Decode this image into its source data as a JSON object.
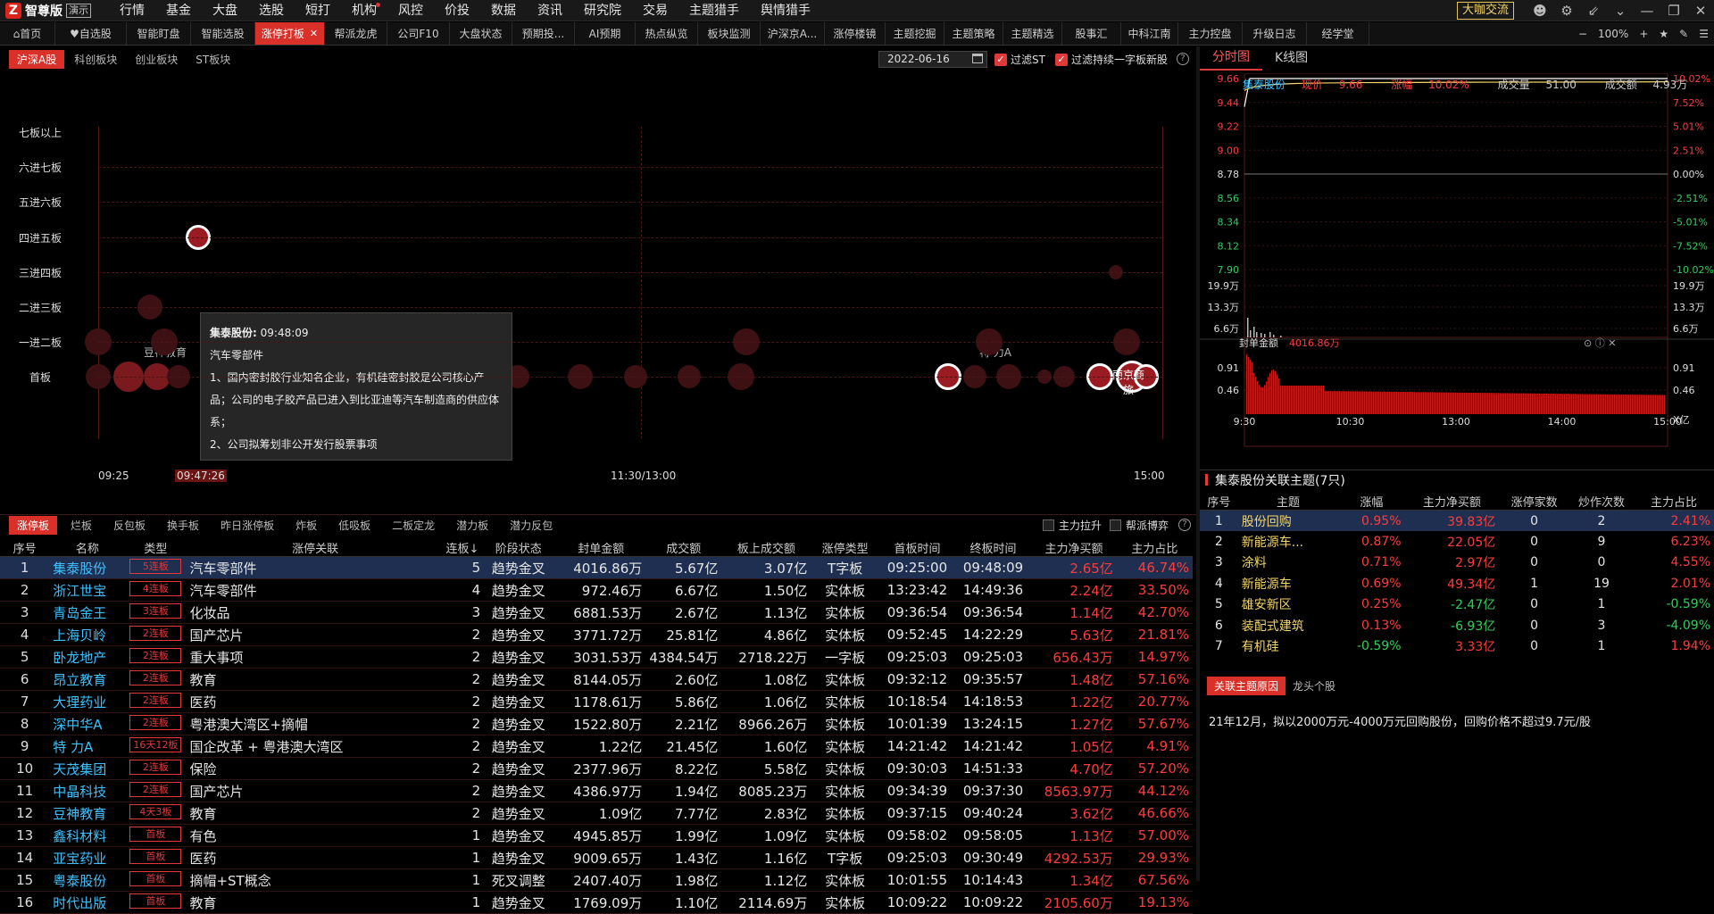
{
  "app": {
    "logo_mark": "Z",
    "name": "智尊版",
    "demo": "演示"
  },
  "menu": [
    "行情",
    "基金",
    "大盘",
    "选股",
    "短打",
    "机构",
    "风控",
    "价投",
    "数据",
    "资讯",
    "研究院",
    "交易",
    "主题猎手",
    "舆情猎手"
  ],
  "top_right": {
    "chat": "大咖交流"
  },
  "tabs": [
    {
      "label": "首页",
      "icon": "home-icon",
      "w": 62
    },
    {
      "label": "自选股",
      "icon": "heart-icon",
      "w": 80
    },
    {
      "label": "智能盯盘",
      "w": 72
    },
    {
      "label": "智能选股",
      "w": 72
    },
    {
      "label": "涨停打板",
      "active": true,
      "w": 78
    },
    {
      "label": "帮派龙虎",
      "w": 70
    },
    {
      "label": "公司F10",
      "w": 70
    },
    {
      "label": "大盘状态",
      "w": 70
    },
    {
      "label": "预期投...",
      "w": 70
    },
    {
      "label": "AI预期",
      "w": 68
    },
    {
      "label": "热点纵览",
      "w": 70
    },
    {
      "label": "板块监测",
      "w": 70
    },
    {
      "label": "沪深京A...",
      "w": 72
    },
    {
      "label": "涨停楼镜",
      "w": 68
    },
    {
      "label": "主题挖掘",
      "w": 66
    },
    {
      "label": "主题策略",
      "w": 66
    },
    {
      "label": "主题精选",
      "w": 66
    },
    {
      "label": "股事汇",
      "w": 66
    },
    {
      "label": "中科江南",
      "w": 64
    },
    {
      "label": "主力控盘",
      "w": 72
    },
    {
      "label": "升级日志",
      "w": 72
    },
    {
      "label": "经学堂",
      "w": 70
    }
  ],
  "tab_tools": {
    "minus": "−",
    "zoom": "100%",
    "plus": "+"
  },
  "subtabs": [
    "沪深A股",
    "科创板块",
    "创业板块",
    "ST板块"
  ],
  "filter": {
    "date": "2022-06-16",
    "st": "过滤ST",
    "new": "过滤持续一字板新股"
  },
  "levels": [
    "七板以上",
    "六进七板",
    "五进六板",
    "四进五板",
    "三进四板",
    "二进三板",
    "一进二板",
    "首板"
  ],
  "time_axis": {
    "start": "09:25",
    "cursor": "09:47:26",
    "mid": "11:30/13:00",
    "end": "15:00"
  },
  "bubble_labels": [
    "豆神教育",
    "特 力A",
    "南京商旅"
  ],
  "tooltip": {
    "name": "集泰股份:",
    "time": "09:48:09",
    "sector": "汽车零部件",
    "line1": "1、国内密封胶行业知名企业，有机硅密封胶是公司核心产品；公司的电子胶产品已进入到比亚迪等汽车制造商的供应体系；",
    "line2": "2、公司拟筹划非公开发行股票事项"
  },
  "bottom_tabs": [
    "涨停板",
    "烂板",
    "反包板",
    "换手板",
    "昨日涨停板",
    "炸板",
    "低吸板",
    "二板定龙",
    "潜力板",
    "潜力反包"
  ],
  "bottom_checks": [
    "主力拉升",
    "帮派博弈"
  ],
  "main_headers": [
    "序号",
    "名称",
    "类型",
    "涨停关联",
    "连板↓",
    "阶段状态",
    "封单金额",
    "成交额",
    "板上成交额",
    "涨停类型",
    "首板时间",
    "终板时间",
    "主力净买额",
    "主力占比"
  ],
  "rows": [
    [
      "1",
      "集泰股份",
      "5连板",
      "汽车零部件",
      "5",
      "趋势金叉",
      "4016.86万",
      "5.67亿",
      "3.07亿",
      "T字板",
      "09:25:00",
      "09:48:09",
      "2.65亿",
      "46.74%"
    ],
    [
      "2",
      "浙江世宝",
      "4连板",
      "汽车零部件",
      "4",
      "趋势金叉",
      "972.46万",
      "6.67亿",
      "1.50亿",
      "实体板",
      "13:23:42",
      "14:49:36",
      "2.24亿",
      "33.50%"
    ],
    [
      "3",
      "青岛金王",
      "3连板",
      "化妆品",
      "3",
      "趋势金叉",
      "6881.53万",
      "2.67亿",
      "1.13亿",
      "实体板",
      "09:36:54",
      "09:36:54",
      "1.14亿",
      "42.70%"
    ],
    [
      "4",
      "上海贝岭",
      "2连板",
      "国产芯片",
      "2",
      "趋势金叉",
      "3771.72万",
      "25.81亿",
      "4.86亿",
      "实体板",
      "09:52:45",
      "14:22:29",
      "5.63亿",
      "21.81%"
    ],
    [
      "5",
      "卧龙地产",
      "2连板",
      "重大事项",
      "2",
      "趋势金叉",
      "3031.53万",
      "4384.54万",
      "2718.22万",
      "一字板",
      "09:25:03",
      "09:25:03",
      "656.43万",
      "14.97%"
    ],
    [
      "6",
      "昂立教育",
      "2连板",
      "教育",
      "2",
      "趋势金叉",
      "8144.05万",
      "2.60亿",
      "1.08亿",
      "实体板",
      "09:32:12",
      "09:35:57",
      "1.48亿",
      "57.16%"
    ],
    [
      "7",
      "大理药业",
      "2连板",
      "医药",
      "2",
      "趋势金叉",
      "1178.61万",
      "5.86亿",
      "1.06亿",
      "实体板",
      "10:18:54",
      "14:18:53",
      "1.22亿",
      "20.77%"
    ],
    [
      "8",
      "深中华A",
      "2连板",
      "粤港澳大湾区+摘帽",
      "2",
      "趋势金叉",
      "1522.80万",
      "2.21亿",
      "8966.26万",
      "实体板",
      "10:01:39",
      "13:24:15",
      "1.27亿",
      "57.67%"
    ],
    [
      "9",
      "特 力A",
      "16天12板",
      "国企改革 + 粤港澳大湾区",
      "2",
      "趋势金叉",
      "1.22亿",
      "21.45亿",
      "1.60亿",
      "实体板",
      "14:21:42",
      "14:21:42",
      "1.05亿",
      "4.91%"
    ],
    [
      "10",
      "天茂集团",
      "2连板",
      "保险",
      "2",
      "趋势金叉",
      "2377.96万",
      "8.22亿",
      "5.58亿",
      "实体板",
      "09:30:03",
      "14:51:33",
      "4.70亿",
      "57.20%"
    ],
    [
      "11",
      "中晶科技",
      "2连板",
      "国产芯片",
      "2",
      "趋势金叉",
      "4386.97万",
      "1.94亿",
      "8085.23万",
      "实体板",
      "09:34:39",
      "09:37:30",
      "8563.97万",
      "44.12%"
    ],
    [
      "12",
      "豆神教育",
      "4天3板",
      "教育",
      "2",
      "趋势金叉",
      "1.09亿",
      "7.77亿",
      "2.83亿",
      "实体板",
      "09:37:15",
      "09:40:24",
      "3.62亿",
      "46.66%"
    ],
    [
      "13",
      "鑫科材料",
      "首板",
      "有色",
      "1",
      "趋势金叉",
      "4945.85万",
      "1.99亿",
      "1.09亿",
      "实体板",
      "09:58:02",
      "09:58:05",
      "1.13亿",
      "57.00%"
    ],
    [
      "14",
      "亚宝药业",
      "首板",
      "医药",
      "1",
      "趋势金叉",
      "9009.65万",
      "1.43亿",
      "1.16亿",
      "T字板",
      "09:25:03",
      "09:30:49",
      "4292.53万",
      "29.93%"
    ],
    [
      "15",
      "粤泰股份",
      "首板",
      "摘帽+ST概念",
      "1",
      "死叉调整",
      "2407.40万",
      "1.98亿",
      "1.12亿",
      "实体板",
      "10:01:55",
      "10:14:43",
      "1.34亿",
      "67.56%"
    ],
    [
      "16",
      "时代出版",
      "首板",
      "教育",
      "1",
      "趋势金叉",
      "1769.09万",
      "1.10亿",
      "2114.69万",
      "实体板",
      "10:09:22",
      "10:09:22",
      "2105.60万",
      "19.13%"
    ]
  ],
  "right_tabs": [
    "分时图",
    "K线图"
  ],
  "quote": {
    "name": "集泰股份",
    "price_label": "现价",
    "price": "9.66",
    "chg_label": "涨幅",
    "chg": "10.02%",
    "vol_label": "成交量",
    "vol": "51.00",
    "amt_label": "成交额",
    "amt": "4.93万"
  },
  "price_axis": [
    "9.66",
    "9.44",
    "9.22",
    "9.00",
    "8.78",
    "8.56",
    "8.34",
    "8.12",
    "7.90"
  ],
  "pct_axis": [
    "10.02%",
    "7.52%",
    "5.01%",
    "2.51%",
    "0.00%",
    "-2.51%",
    "-5.01%",
    "-7.52%",
    "-10.02%"
  ],
  "vol_axis": [
    "19.9万",
    "13.3万",
    "6.6万"
  ],
  "seal": {
    "label": "封单金额",
    "value": "4016.86万",
    "axis": [
      "0.91",
      "0.46"
    ],
    "unit": "X亿"
  },
  "time_ticks": [
    "9:30",
    "10:30",
    "13:00",
    "14:00",
    "15:00"
  ],
  "chart_data": {
    "type": "line",
    "x": [
      "9:30",
      "10:30",
      "13:00",
      "14:00",
      "15:00"
    ],
    "series": [
      {
        "values": [
          9.66,
          9.66,
          9.66,
          9.66,
          9.66
        ]
      }
    ],
    "ylim": [
      7.9,
      9.66
    ]
  },
  "rel_title": "集泰股份关联主题(7只)",
  "side_headers": [
    "序号",
    "主题",
    "涨幅",
    "主力净买额",
    "涨停家数",
    "炒作次数",
    "主力占比"
  ],
  "side_rows": [
    [
      "1",
      "股份回购",
      "0.95%",
      "39.83亿",
      "0",
      "2",
      "2.41%"
    ],
    [
      "2",
      "新能源车...",
      "0.87%",
      "22.05亿",
      "0",
      "9",
      "6.23%"
    ],
    [
      "3",
      "涂料",
      "0.71%",
      "2.97亿",
      "0",
      "0",
      "4.55%"
    ],
    [
      "4",
      "新能源车",
      "0.69%",
      "49.34亿",
      "1",
      "19",
      "2.01%"
    ],
    [
      "5",
      "雄安新区",
      "0.25%",
      "-2.47亿",
      "0",
      "1",
      "-0.59%"
    ],
    [
      "6",
      "装配式建筑",
      "0.13%",
      "-6.93亿",
      "0",
      "3",
      "-4.09%"
    ],
    [
      "7",
      "有机硅",
      "-0.59%",
      "3.33亿",
      "0",
      "1",
      "1.94%"
    ]
  ],
  "reason_tabs": [
    "关联主题原因",
    "龙头个股"
  ],
  "reason_text": "21年12月，拟以2000万元-4000万元回购股份，回购价格不超过9.7元/股",
  "colors": {
    "accent": "#d9302a",
    "rise": "#ff3c3c",
    "fall": "#2fd15a",
    "name": "#3ec1ff"
  }
}
